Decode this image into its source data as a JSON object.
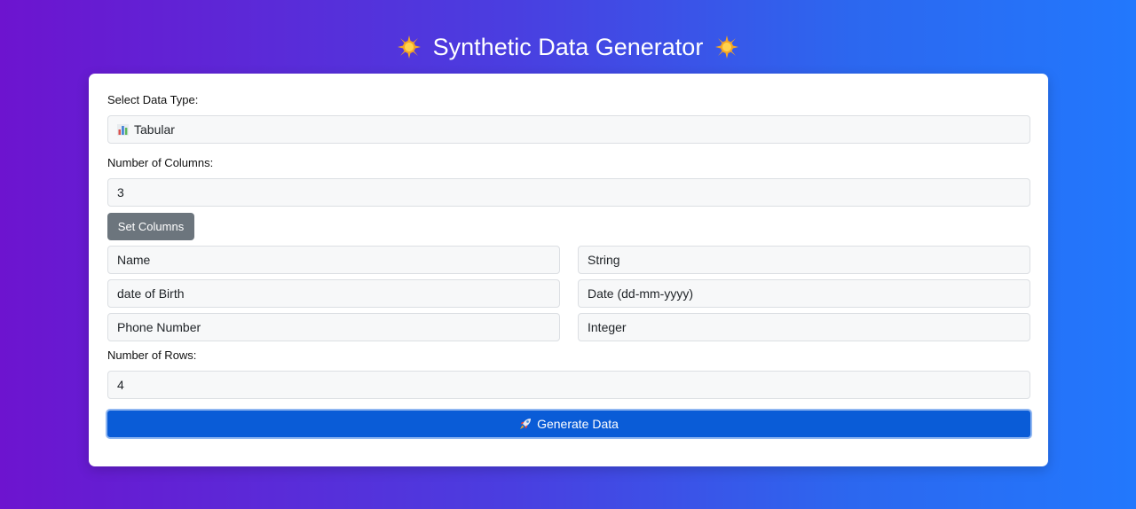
{
  "header": {
    "title": "Synthetic Data Generator",
    "left_icon": "sparkle-icon",
    "right_icon": "sparkle-icon"
  },
  "form": {
    "data_type_label": "Select Data Type:",
    "data_type_value": "Tabular",
    "data_type_icon": "bar-chart-icon",
    "columns_label": "Number of Columns:",
    "columns_value": "3",
    "set_columns_label": "Set Columns",
    "columns": [
      {
        "name": "Name",
        "type": "String"
      },
      {
        "name": "date of Birth",
        "type": "Date (dd-mm-yyyy)"
      },
      {
        "name": "Phone Number",
        "type": "Integer"
      }
    ],
    "rows_label": "Number of Rows:",
    "rows_value": "4",
    "generate_label": "Generate Data",
    "generate_icon": "rocket-icon"
  },
  "colors": {
    "gradient_start": "#6d14cf",
    "gradient_end": "#2278fd",
    "primary_button": "#0a5cd7",
    "secondary_button": "#6c757d"
  }
}
